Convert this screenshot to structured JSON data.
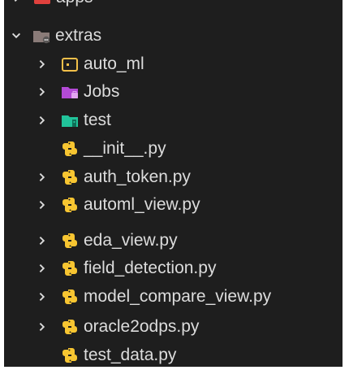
{
  "explorer": {
    "top_item": {
      "label": "apps",
      "icon": "folder-red-apps-icon"
    },
    "extras": {
      "label": "extras",
      "icon": "folder-extras-icon",
      "expanded": true
    },
    "children": [
      {
        "label": "auto_ml",
        "icon": "folder-outline-icon",
        "kind": "folder",
        "collapsed": true
      },
      {
        "label": "Jobs",
        "icon": "folder-jobs-icon",
        "kind": "folder",
        "collapsed": true
      },
      {
        "label": "test",
        "icon": "folder-test-icon",
        "kind": "folder",
        "collapsed": true
      },
      {
        "label": "__init__.py",
        "icon": "python-icon",
        "kind": "file"
      },
      {
        "label": "auth_token.py",
        "icon": "python-icon",
        "kind": "file-expandable",
        "collapsed": true
      },
      {
        "label": "automl_view.py",
        "icon": "python-icon",
        "kind": "file-expandable",
        "collapsed": true
      },
      {
        "label": "eda_view.py",
        "icon": "python-icon",
        "kind": "file-expandable",
        "collapsed": true
      },
      {
        "label": "field_detection.py",
        "icon": "python-icon",
        "kind": "file-expandable",
        "collapsed": true
      },
      {
        "label": "model_compare_view.py",
        "icon": "python-icon",
        "kind": "file-expandable",
        "collapsed": true
      },
      {
        "label": "oracle2odps.py",
        "icon": "python-icon",
        "kind": "file-expandable",
        "collapsed": true
      },
      {
        "label": "test_data.py",
        "icon": "python-icon",
        "kind": "file"
      }
    ]
  },
  "colors": {
    "background": "#1e1e1e",
    "text": "#dcdcdc",
    "python_yellow": "#f7c531",
    "jobs_purple": "#b34ad6",
    "test_teal": "#21c39a",
    "folder_outline": "#f2c04a",
    "extras_folder": "#8a7b78",
    "apps_red": "#e0413d"
  }
}
